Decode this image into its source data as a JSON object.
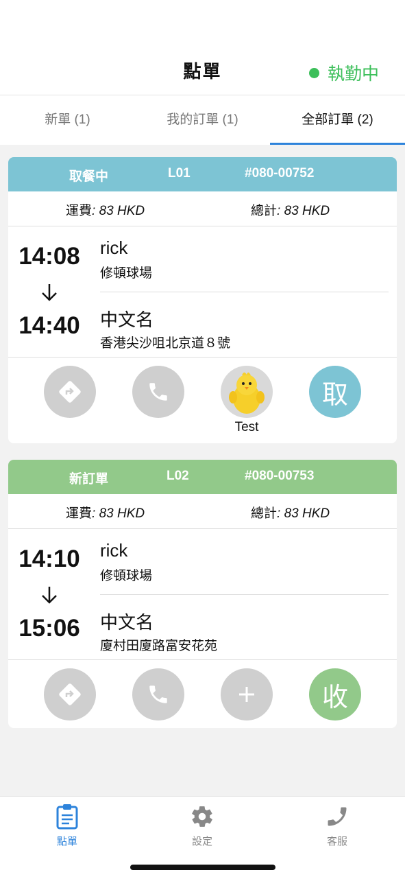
{
  "header": {
    "title": "點單",
    "status_label": "執勤中",
    "status_color": "#3cbf5a"
  },
  "tabs": [
    {
      "label": "新單 (1)",
      "active": false
    },
    {
      "label": "我的訂單 (1)",
      "active": false
    },
    {
      "label": "全部訂單 (2)",
      "active": true
    }
  ],
  "orders": [
    {
      "status": "取餐中",
      "code": "L01",
      "number": "#080-00752",
      "header_color": "#7dc4d4",
      "fee_label": "運費",
      "fee_value": ": 83 HKD",
      "total_label": "總計",
      "total_value": ": 83 HKD",
      "pickup_time": "14:08",
      "pickup_name": "rick",
      "pickup_addr": "修頓球場",
      "dropoff_time": "14:40",
      "dropoff_name": "中文名",
      "dropoff_addr": "香港尖沙咀北京道８號",
      "courier_label": "Test",
      "action_label": "取",
      "action_color": "#7dc4d4"
    },
    {
      "status": "新訂單",
      "code": "L02",
      "number": "#080-00753",
      "header_color": "#92c98a",
      "fee_label": "運費",
      "fee_value": ": 83 HKD",
      "total_label": "總計",
      "total_value": ": 83 HKD",
      "pickup_time": "14:10",
      "pickup_name": "rick",
      "pickup_addr": "修頓球場",
      "dropoff_time": "15:06",
      "dropoff_name": "中文名",
      "dropoff_addr": "廈村田廈路富安花苑",
      "action_label": "收",
      "action_color": "#92c98a"
    }
  ],
  "bottom_nav": [
    {
      "label": "點單",
      "icon": "clipboard-icon",
      "active": true
    },
    {
      "label": "設定",
      "icon": "gear-icon",
      "active": false
    },
    {
      "label": "客服",
      "icon": "phone-icon",
      "active": false
    }
  ],
  "accent_color": "#2d83db"
}
